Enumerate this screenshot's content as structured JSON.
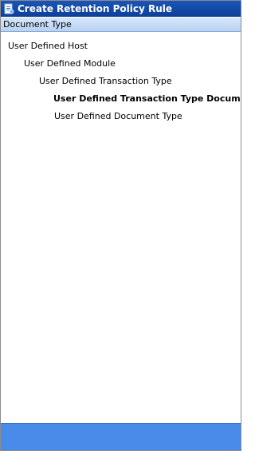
{
  "window": {
    "title": "Create Retention Policy Rule"
  },
  "panel": {
    "header": "Document Type"
  },
  "tree": {
    "items": [
      {
        "label": "User Defined Host",
        "level": 0,
        "selected": false
      },
      {
        "label": "User Defined Module",
        "level": 1,
        "selected": false
      },
      {
        "label": "User Defined Transaction Type",
        "level": 2,
        "selected": false
      },
      {
        "label": "User Defined Transaction Type Documentati",
        "level": 3,
        "selected": true
      },
      {
        "label": "User Defined Document Type",
        "level": 3,
        "selected": false
      }
    ]
  },
  "colors": {
    "titlebar": "#0d3f98",
    "panel_header": "#c7ddf6",
    "footer": "#4a8ae8"
  },
  "icons": {
    "app": "document-icon"
  }
}
